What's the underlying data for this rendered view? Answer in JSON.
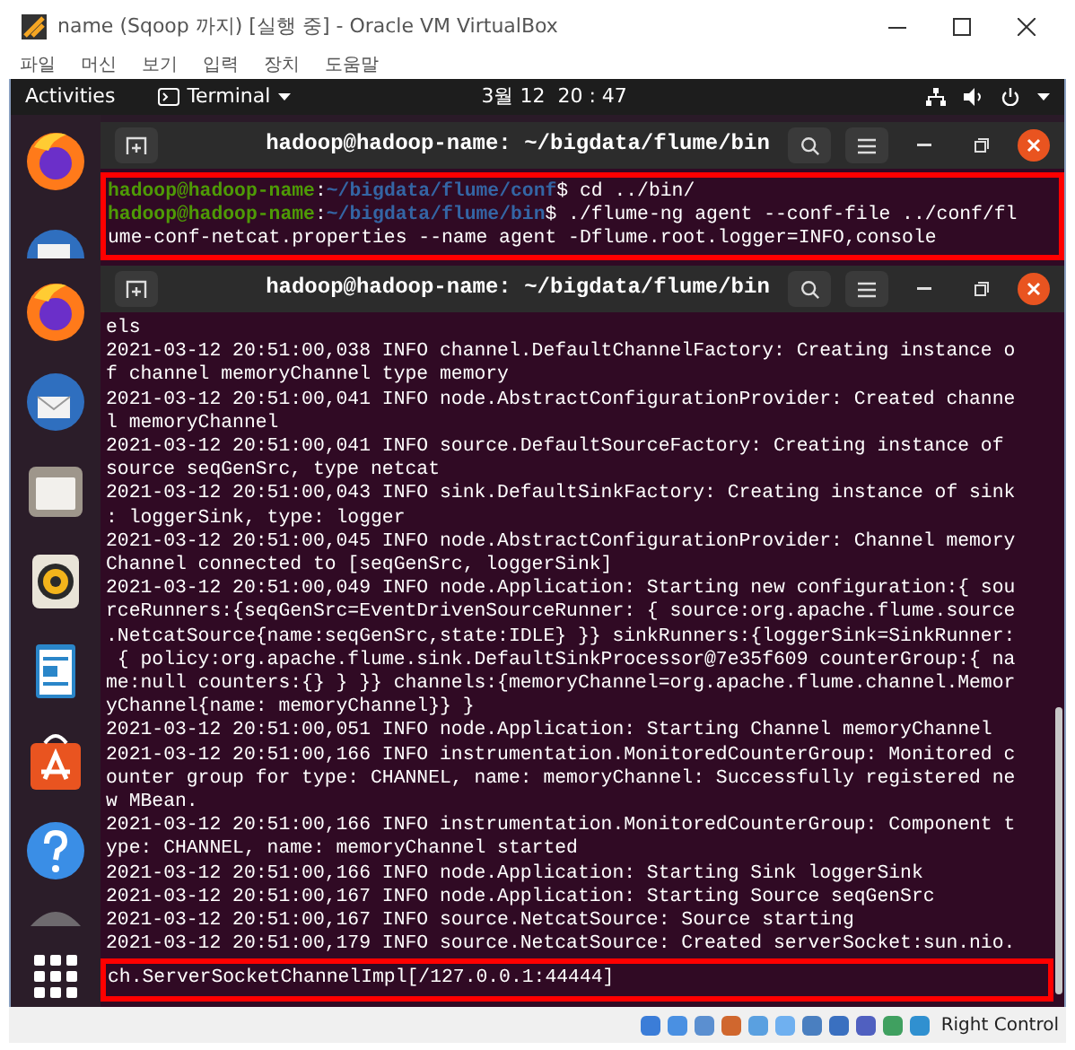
{
  "window": {
    "title": "name (Sqoop 까지) [실행 중] - Oracle VM VirtualBox"
  },
  "menu": [
    "파일",
    "머신",
    "보기",
    "입력",
    "장치",
    "도움말"
  ],
  "top_bar": {
    "activities": "Activities",
    "app": "Terminal",
    "clock": "3월 12  20 : 47"
  },
  "terminals": [
    {
      "title": "hadoop@hadoop-name: ~/bigdata/flume/bin",
      "highlighted": true,
      "lines": [
        {
          "kind": "prompt",
          "user": "hadoop@hadoop-name",
          "separator": ":",
          "path": "~/bigdata/flume/conf",
          "command": "$ cd ../bin/"
        },
        {
          "kind": "prompt",
          "user": "hadoop@hadoop-name",
          "separator": ":",
          "path": "~/bigdata/flume/bin",
          "command": "$ ./flume-ng agent --conf-file ../conf/fl"
        },
        {
          "kind": "output",
          "text": "ume-conf-netcat.properties --name agent -Dflume.root.logger=INFO,console"
        }
      ]
    },
    {
      "title": "hadoop@hadoop-name: ~/bigdata/flume/bin",
      "lines": [
        {
          "kind": "output",
          "text": "els"
        },
        {
          "kind": "output",
          "text": "2021-03-12 20:51:00,038 INFO channel.DefaultChannelFactory: Creating instance o"
        },
        {
          "kind": "output",
          "text": "f channel memoryChannel type memory"
        },
        {
          "kind": "output",
          "text": "2021-03-12 20:51:00,041 INFO node.AbstractConfigurationProvider: Created channe"
        },
        {
          "kind": "output",
          "text": "l memoryChannel"
        },
        {
          "kind": "output",
          "text": "2021-03-12 20:51:00,041 INFO source.DefaultSourceFactory: Creating instance of"
        },
        {
          "kind": "output",
          "text": "source seqGenSrc, type netcat"
        },
        {
          "kind": "output",
          "text": "2021-03-12 20:51:00,043 INFO sink.DefaultSinkFactory: Creating instance of sink"
        },
        {
          "kind": "output",
          "text": ": loggerSink, type: logger"
        },
        {
          "kind": "output",
          "text": "2021-03-12 20:51:00,045 INFO node.AbstractConfigurationProvider: Channel memory"
        },
        {
          "kind": "output",
          "text": "Channel connected to [seqGenSrc, loggerSink]"
        },
        {
          "kind": "output",
          "text": "2021-03-12 20:51:00,049 INFO node.Application: Starting new configuration:{ sou"
        },
        {
          "kind": "output",
          "text": "rceRunners:{seqGenSrc=EventDrivenSourceRunner: { source:org.apache.flume.source"
        },
        {
          "kind": "output",
          "text": ".NetcatSource{name:seqGenSrc,state:IDLE} }} sinkRunners:{loggerSink=SinkRunner:"
        },
        {
          "kind": "output",
          "text": " { policy:org.apache.flume.sink.DefaultSinkProcessor@7e35f609 counterGroup:{ na"
        },
        {
          "kind": "output",
          "text": "me:null counters:{} } }} channels:{memoryChannel=org.apache.flume.channel.Memor"
        },
        {
          "kind": "output",
          "text": "yChannel{name: memoryChannel}} }"
        },
        {
          "kind": "output",
          "text": "2021-03-12 20:51:00,051 INFO node.Application: Starting Channel memoryChannel"
        },
        {
          "kind": "output",
          "text": "2021-03-12 20:51:00,166 INFO instrumentation.MonitoredCounterGroup: Monitored c"
        },
        {
          "kind": "output",
          "text": "ounter group for type: CHANNEL, name: memoryChannel: Successfully registered ne"
        },
        {
          "kind": "output",
          "text": "w MBean."
        },
        {
          "kind": "output",
          "text": "2021-03-12 20:51:00,166 INFO instrumentation.MonitoredCounterGroup: Component t"
        },
        {
          "kind": "output",
          "text": "ype: CHANNEL, name: memoryChannel started"
        },
        {
          "kind": "output",
          "text": "2021-03-12 20:51:00,166 INFO node.Application: Starting Sink loggerSink"
        },
        {
          "kind": "output",
          "text": "2021-03-12 20:51:00,167 INFO node.Application: Starting Source seqGenSrc"
        },
        {
          "kind": "output",
          "text": "2021-03-12 20:51:00,167 INFO source.NetcatSource: Source starting"
        },
        {
          "kind": "output",
          "text": "2021-03-12 20:51:00,179 INFO source.NetcatSource: Created serverSocket:sun.nio."
        },
        {
          "kind": "highlight",
          "text": "ch.ServerSocketChannelImpl[/127.0.0.1:44444]"
        }
      ]
    }
  ],
  "status_bar": {
    "host_key": "Right Control"
  }
}
